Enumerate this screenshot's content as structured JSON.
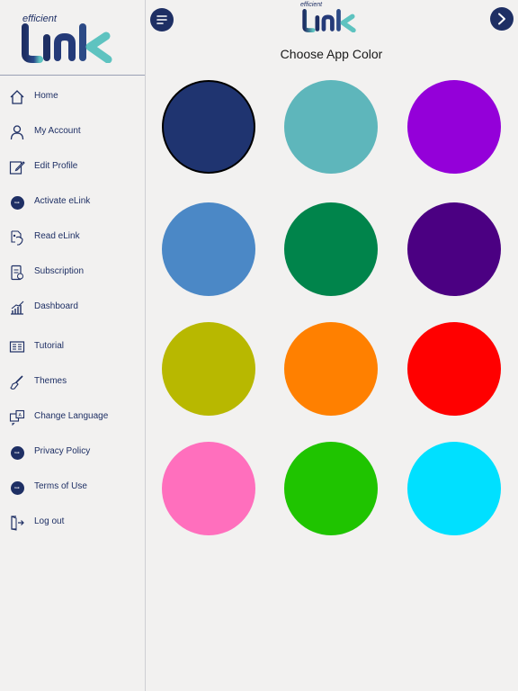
{
  "logo": {
    "tagline": "efficient",
    "wordmark": "link"
  },
  "header": {
    "title": "Choose App Color"
  },
  "sidebar": {
    "items": [
      {
        "label": "Home",
        "icon": "home-icon"
      },
      {
        "label": "My Account",
        "icon": "user-icon"
      },
      {
        "label": "Edit Profile",
        "icon": "edit-icon"
      },
      {
        "label": "Activate eLink",
        "icon": "elink-badge-icon"
      },
      {
        "label": "Read eLink",
        "icon": "scan-icon"
      },
      {
        "label": "Subscription",
        "icon": "subscription-icon"
      },
      {
        "label": "Dashboard",
        "icon": "chart-icon"
      },
      {
        "label": "Tutorial",
        "icon": "tutorial-icon"
      },
      {
        "label": "Themes",
        "icon": "brush-icon"
      },
      {
        "label": "Change Language",
        "icon": "language-icon"
      },
      {
        "label": "Privacy Policy",
        "icon": "elink-badge-icon"
      },
      {
        "label": "Terms of Use",
        "icon": "elink-badge-icon"
      },
      {
        "label": "Log out",
        "icon": "logout-icon"
      }
    ]
  },
  "colors": {
    "selected_index": 0,
    "swatches": [
      "#1f3470",
      "#5eb6bb",
      "#9400d9",
      "#4b88c6",
      "#00844b",
      "#4b0082",
      "#b8b800",
      "#ff8000",
      "#ff0000",
      "#ff6fbd",
      "#1fc400",
      "#00e0ff"
    ]
  },
  "theme": {
    "accent": "#1e2f64",
    "logo_teal": "#5ec3c0"
  }
}
